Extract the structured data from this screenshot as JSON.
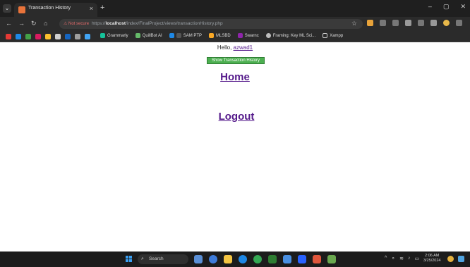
{
  "browser": {
    "tab_title": "Transaction History",
    "tab_close": "×",
    "new_tab": "+",
    "window_controls": [
      "–",
      "▢",
      "✕"
    ],
    "security_label": "Not secure",
    "url_prefix": "https://",
    "url_host": "localhost",
    "url_path": "/index/FinalProject/views/transactionHistory.php",
    "bookmarks": [
      "Grammarly",
      "QuillBot AI",
      "SAM PTP",
      "MLSBD",
      "Swarnc",
      "Framing: Key ML Sci...",
      "Xampp"
    ]
  },
  "page": {
    "greeting_prefix": "Hello, ",
    "username": "azwad1",
    "show_history_button": "Show Transaction History",
    "home_link": "Home",
    "logout_link": "Logout"
  },
  "taskbar": {
    "search_label": "Search",
    "time": "2:06 AM",
    "date": "3/25/2024"
  },
  "colors": {
    "link": "#551a8b",
    "button_green": "#4caf50",
    "browser_dark": "#2b2b2b"
  }
}
